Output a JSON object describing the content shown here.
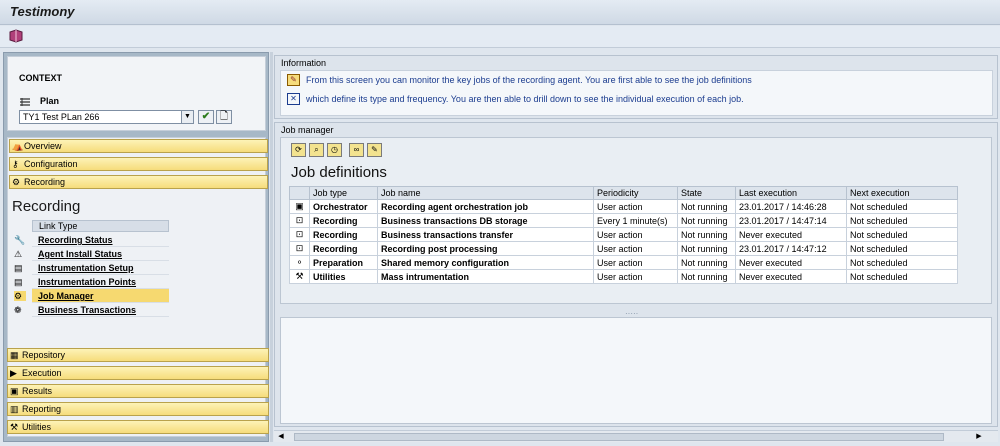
{
  "window": {
    "title": "Testimony"
  },
  "context": {
    "label": "CONTEXT",
    "plan_label": "Plan",
    "plan_value": "TY1 Test PLan 266"
  },
  "nav": {
    "top": [
      {
        "label": "Overview",
        "icon": "overview-icon"
      },
      {
        "label": "Configuration",
        "icon": "key-icon"
      },
      {
        "label": "Recording",
        "icon": "recording-icon"
      }
    ],
    "section_title": "Recording",
    "link_header": "Link Type",
    "links": [
      {
        "label": "Recording Status",
        "icon": "wrench-icon",
        "selected": false
      },
      {
        "label": "Agent Install Status",
        "icon": "warning-icon",
        "selected": false
      },
      {
        "label": "Instrumentation Setup",
        "icon": "document-icon",
        "selected": false
      },
      {
        "label": "Instrumentation Points",
        "icon": "document-icon",
        "selected": false
      },
      {
        "label": "Job Manager",
        "icon": "job-icon",
        "selected": true
      },
      {
        "label": "Business Transactions",
        "icon": "transaction-icon",
        "selected": false
      }
    ],
    "bottom": [
      {
        "label": "Repository",
        "icon": "repository-icon"
      },
      {
        "label": "Execution",
        "icon": "execution-icon"
      },
      {
        "label": "Results",
        "icon": "results-icon"
      },
      {
        "label": "Reporting",
        "icon": "reporting-icon"
      },
      {
        "label": "Utilities",
        "icon": "utilities-icon"
      }
    ]
  },
  "information": {
    "header": "Information",
    "line1": "From this screen you can monitor the key jobs of the recording agent. You are first able to see the job definitions",
    "line2": "which define its type and frequency. You are then able to drill down to see the individual execution of each job."
  },
  "job_manager": {
    "header": "Job manager",
    "title": "Job definitions",
    "columns": [
      "Job type",
      "Job name",
      "Periodicity",
      "State",
      "Last execution",
      "Next execution"
    ],
    "rows": [
      {
        "icon": "orchestrator-icon",
        "type": "Orchestrator",
        "name": "Recording agent orchestration job",
        "periodicity": "User action",
        "state": "Not running",
        "last": "23.01.2017 / 14:46:28",
        "next": "Not scheduled"
      },
      {
        "icon": "recording-job-icon",
        "type": "Recording",
        "name": "Business transactions DB storage",
        "periodicity": "Every 1 minute(s)",
        "state": "Not running",
        "last": "23.01.2017 / 14:47:14",
        "next": "Not scheduled"
      },
      {
        "icon": "recording-job-icon",
        "type": "Recording",
        "name": "Business transactions transfer",
        "periodicity": "User action",
        "state": "Not running",
        "last": "Never executed",
        "next": "Not scheduled"
      },
      {
        "icon": "recording-job-icon",
        "type": "Recording",
        "name": "Recording post processing",
        "periodicity": "User action",
        "state": "Not running",
        "last": "23.01.2017 / 14:47:12",
        "next": "Not scheduled"
      },
      {
        "icon": "preparation-icon",
        "type": "Preparation",
        "name": "Shared memory configuration",
        "periodicity": "User action",
        "state": "Not running",
        "last": "Never executed",
        "next": "Not scheduled"
      },
      {
        "icon": "utilities-icon",
        "type": "Utilities",
        "name": "Mass intrumentation",
        "periodicity": "User action",
        "state": "Not running",
        "last": "Never executed",
        "next": "Not scheduled"
      }
    ]
  }
}
